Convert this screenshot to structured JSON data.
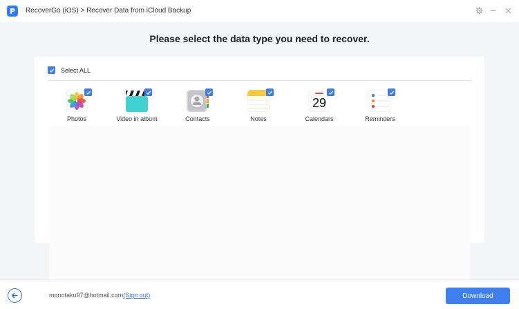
{
  "titlebar": {
    "breadcrumb": "RecoverGo (iOS) > Recover Data from iCloud Backup"
  },
  "headline": "Please select the data type you need to recover.",
  "select_all": {
    "label": "Select ALL",
    "checked": true
  },
  "data_types": [
    {
      "label": "Photos",
      "icon": "photos-icon",
      "checked": true
    },
    {
      "label": "Video in album",
      "icon": "video-icon",
      "checked": true
    },
    {
      "label": "Contacts",
      "icon": "contacts-icon",
      "checked": true
    },
    {
      "label": "Notes",
      "icon": "notes-icon",
      "checked": true
    },
    {
      "label": "Calendars",
      "icon": "calendar-icon",
      "checked": true,
      "day": "29"
    },
    {
      "label": "Reminders",
      "icon": "reminders-icon",
      "checked": true
    }
  ],
  "footer": {
    "account_email": "monotaku97@hotmail.com",
    "sign_out_label": "(Sign out)",
    "download_label": "Download"
  },
  "colors": {
    "accent": "#3e80f0",
    "background": "#f4f5f8"
  }
}
